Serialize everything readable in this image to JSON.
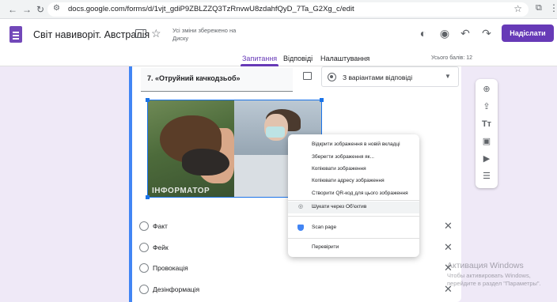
{
  "browser": {
    "back_icon": "arrow-left",
    "forward_icon": "arrow-right",
    "reload_icon": "reload",
    "url": "docs.google.com/forms/d/1vjt_gdiP9ZBLZZQ3TzRnvwU8zdahfQyD_7Ta_G2Xg_c/edit"
  },
  "header": {
    "title": "Світ навиворіт. Австралія",
    "save_status": "Усі зміни збережено на Диску",
    "send_label": "Надіслати",
    "accent_color": "#673ab7"
  },
  "tabs": [
    {
      "label": "Запитання",
      "active": true
    },
    {
      "label": "Відповіді",
      "active": false
    },
    {
      "label": "Налаштування",
      "active": false
    }
  ],
  "score": "Усього балів: 12",
  "question": {
    "title": "7. «Отруйний качкодзьоб»",
    "type_label": "З варіантами відповіді",
    "image_watermark": "ІНФОРМАТОР",
    "options": [
      "Факт",
      "Фейк",
      "Провокація",
      "Дезінформація"
    ]
  },
  "context_menu": {
    "items": [
      "Відкрити зображення в новій вкладці",
      "Зберегти зображення як...",
      "Копіювати зображення",
      "Копіювати адресу зображення",
      "Створити QR-код для цього зображення",
      "Шукати через Об'єктив",
      "Scan page",
      "Перевірити"
    ]
  },
  "os_watermark": {
    "title": "Активация Windows",
    "subtitle": "Чтобы активировать Windows, перейдите в раздел \"Параметры\"."
  }
}
